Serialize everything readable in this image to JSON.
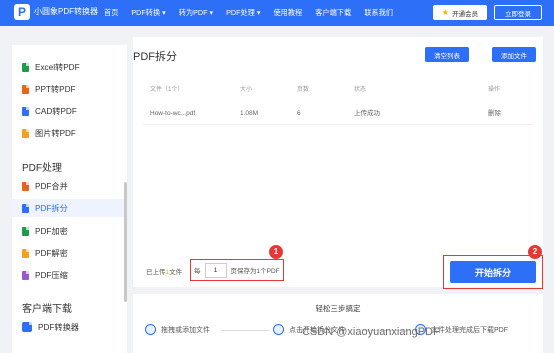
{
  "header": {
    "logo_glyph": "P",
    "app_name": "小圆象PDF转换器",
    "nav": [
      "首页",
      "PDF转换 ▾",
      "转为PDF ▾",
      "PDF处理 ▾",
      "使用教程",
      "客户端下载",
      "联系我们"
    ],
    "vip_label": "开通会员",
    "login_label": "立即登录"
  },
  "sidebar": {
    "convert_items": [
      {
        "label": "Excel转PDF",
        "color": "#1d9d4b"
      },
      {
        "label": "PPT转PDF",
        "color": "#e8641d"
      },
      {
        "label": "CAD转PDF",
        "color": "#2d6ff7"
      },
      {
        "label": "图片转PDF",
        "color": "#f7a01d"
      }
    ],
    "process_heading": "PDF处理",
    "process_items": [
      {
        "label": "PDF合并",
        "color": "#e8641d"
      },
      {
        "label": "PDF拆分",
        "color": "#2d6ff7",
        "active": true
      },
      {
        "label": "PDF加密",
        "color": "#1d9d4b"
      },
      {
        "label": "PDF解密",
        "color": "#f7a01d"
      },
      {
        "label": "PDF压缩",
        "color": "#9b59d0"
      }
    ],
    "client_heading": "客户端下载",
    "client_item": "PDF转换器"
  },
  "main": {
    "title": "PDF拆分",
    "clear_label": "清空列表",
    "add_label": "添加文件",
    "columns": {
      "file": "文件（1个）",
      "size": "大小",
      "pages": "页数",
      "status": "状态",
      "action": "操作"
    },
    "rows": [
      {
        "file": "How-to-wc...pdf",
        "size": "1.08M",
        "pages": "6",
        "status": "上传成功",
        "action": "删除"
      }
    ],
    "upload_prefix": "已上传",
    "upload_count": "1",
    "upload_suffix": "文件",
    "per_prefix": "每",
    "per_value": "1",
    "per_suffix": "页保存为1个PDF",
    "start_label": "开始拆分",
    "badge_1": "1",
    "badge_2": "2"
  },
  "steps": {
    "title": "轻松三步搞定",
    "items": [
      "拖拽或添加文件",
      "点击开始拆分文件",
      "文件处理完成后下载PDF"
    ]
  },
  "watermark": "CSDN @xiaoyuanxiangPDF",
  "colors": {
    "brand": "#2d6ff7",
    "highlight": "#e53935"
  }
}
